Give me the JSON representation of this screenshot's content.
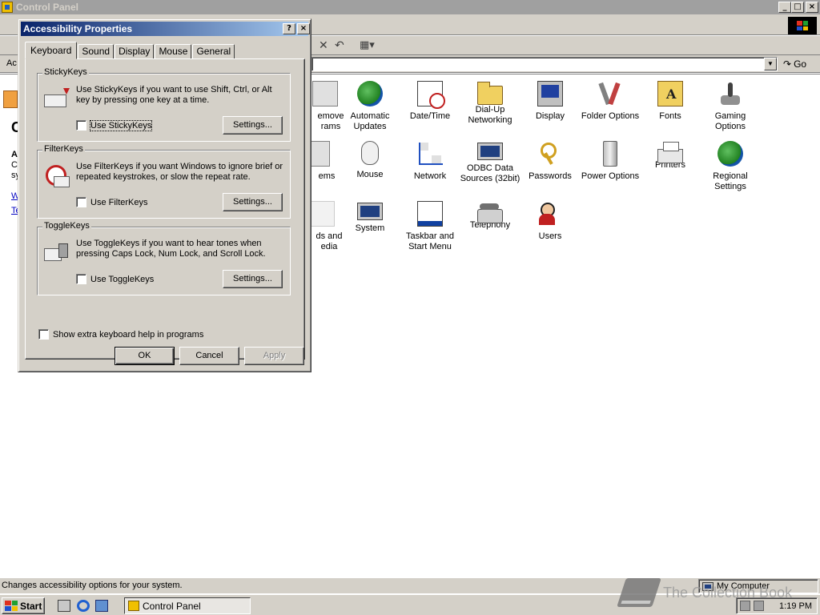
{
  "main_window": {
    "title": "Control Panel",
    "buttons": {
      "minimize": "_",
      "maximize": "□",
      "close": "×"
    }
  },
  "addressbar": {
    "label": "Ac",
    "go_label": "Go"
  },
  "left_pane": {
    "fragments": [
      "A",
      "Cl",
      "sy",
      "W",
      "Te",
      "C"
    ]
  },
  "items": [
    {
      "label": "emove\nrams",
      "icon": "partial-icon"
    },
    {
      "label": "Automatic Updates",
      "icon": "globe-icon"
    },
    {
      "label": "Date/Time",
      "icon": "calendar-clock-icon"
    },
    {
      "label": "Dial-Up Networking",
      "icon": "folder-network-icon"
    },
    {
      "label": "Display",
      "icon": "monitor-icon"
    },
    {
      "label": "Folder Options",
      "icon": "folder-tools-icon"
    },
    {
      "label": "Fonts",
      "icon": "fonts-folder-icon"
    },
    {
      "label": "Gaming Options",
      "icon": "joystick-icon"
    },
    {
      "label": "ems",
      "icon": "partial-icon"
    },
    {
      "label": "Mouse",
      "icon": "mouse-icon"
    },
    {
      "label": "Network",
      "icon": "network-icon"
    },
    {
      "label": "ODBC Data Sources (32bit)",
      "icon": "database-icon"
    },
    {
      "label": "Passwords",
      "icon": "keys-icon"
    },
    {
      "label": "Power Options",
      "icon": "battery-icon"
    },
    {
      "label": "Printers",
      "icon": "printer-icon"
    },
    {
      "label": "Regional Settings",
      "icon": "globe-icon"
    },
    {
      "label": "ds and\nedia",
      "icon": "partial-icon"
    },
    {
      "label": "System",
      "icon": "computer-icon"
    },
    {
      "label": "Taskbar and Start Menu",
      "icon": "taskbar-icon"
    },
    {
      "label": "Telephony",
      "icon": "telephone-icon"
    },
    {
      "label": "Users",
      "icon": "users-icon"
    }
  ],
  "statusbar": {
    "text": "Changes accessibility options for your system.",
    "zone": "My Computer"
  },
  "taskbar": {
    "start_label": "Start",
    "task_label": "Control Panel",
    "clock": "1:19 PM"
  },
  "watermark": {
    "text": "The Collection Book"
  },
  "dialog": {
    "title": "Accessibility Properties",
    "help": "?",
    "close": "×",
    "tabs": [
      {
        "label": "Keyboard",
        "active": true
      },
      {
        "label": "Sound",
        "active": false
      },
      {
        "label": "Display",
        "active": false
      },
      {
        "label": "Mouse",
        "active": false
      },
      {
        "label": "General",
        "active": false
      }
    ],
    "groups": [
      {
        "label": "StickyKeys",
        "description": "Use StickyKeys if you want to use Shift, Ctrl, or Alt key by pressing one key at a time.",
        "checkbox": "Use StickyKeys",
        "checked": false,
        "button": "Settings..."
      },
      {
        "label": "FilterKeys",
        "description": "Use FilterKeys if you want Windows to ignore brief or repeated keystrokes, or slow the repeat rate.",
        "checkbox": "Use FilterKeys",
        "checked": false,
        "button": "Settings..."
      },
      {
        "label": "ToggleKeys",
        "description": "Use ToggleKeys if you want to hear tones when pressing Caps Lock, Num Lock, and Scroll Lock.",
        "checkbox": "Use ToggleKeys",
        "checked": false,
        "button": "Settings..."
      }
    ],
    "extra_help": "Show extra keyboard help in programs",
    "buttons": {
      "ok": "OK",
      "cancel": "Cancel",
      "apply": "Apply"
    }
  }
}
